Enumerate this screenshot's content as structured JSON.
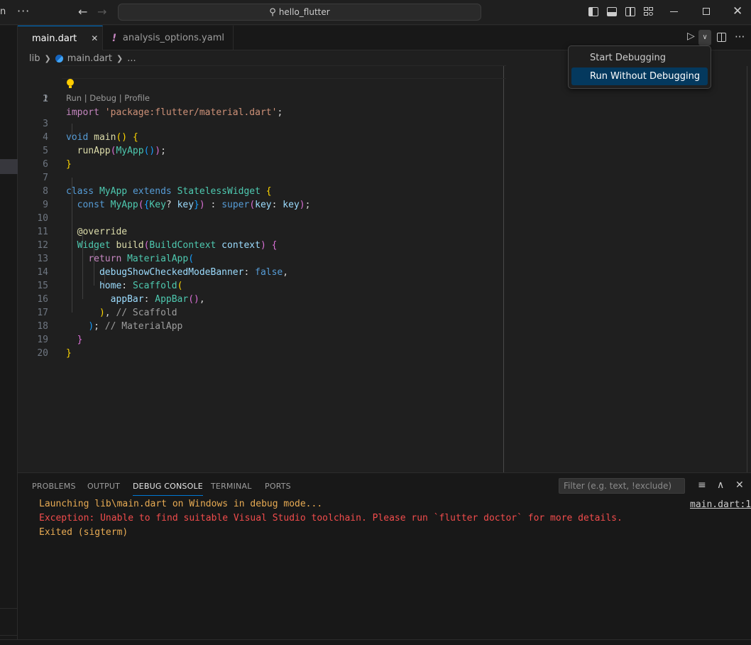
{
  "titlebar": {
    "search_text": "hello_flutter",
    "left_cut_text": "n"
  },
  "tabs": [
    {
      "label": "main.dart",
      "active": true
    },
    {
      "label": "analysis_options.yaml",
      "active": false
    }
  ],
  "breadcrumb": {
    "folder": "lib",
    "file": "main.dart",
    "more": "..."
  },
  "editor": {
    "codelens": "Run | Debug | Profile",
    "line_numbers": [
      "1",
      "2",
      "3",
      "4",
      "5",
      "6",
      "7",
      "8",
      "9",
      "10",
      "11",
      "12",
      "13",
      "14",
      "15",
      "16",
      "17",
      "18",
      "19",
      "20"
    ],
    "active_line": 1
  },
  "run_menu": {
    "items": [
      {
        "label": "Start Debugging",
        "selected": false
      },
      {
        "label": "Run Without Debugging",
        "selected": true
      }
    ]
  },
  "panel": {
    "tabs": [
      "PROBLEMS",
      "OUTPUT",
      "DEBUG CONSOLE",
      "TERMINAL",
      "PORTS"
    ],
    "active_tab": "DEBUG CONSOLE",
    "filter_placeholder": "Filter (e.g. text, !exclude)",
    "console": [
      {
        "text": "Launching lib\\main.dart on Windows in debug mode...",
        "level": "warn"
      },
      {
        "text": "Exception: Unable to find suitable Visual Studio toolchain. Please run `flutter doctor` for more details.",
        "level": "error"
      },
      {
        "text": "Exited (sigterm)",
        "level": "warn"
      }
    ],
    "source_link": "main.dart:1"
  },
  "colors": {
    "accent": "#0078d4",
    "menu_selected": "#04395e",
    "error": "#f14c4c",
    "warning": "#e8ab53"
  }
}
